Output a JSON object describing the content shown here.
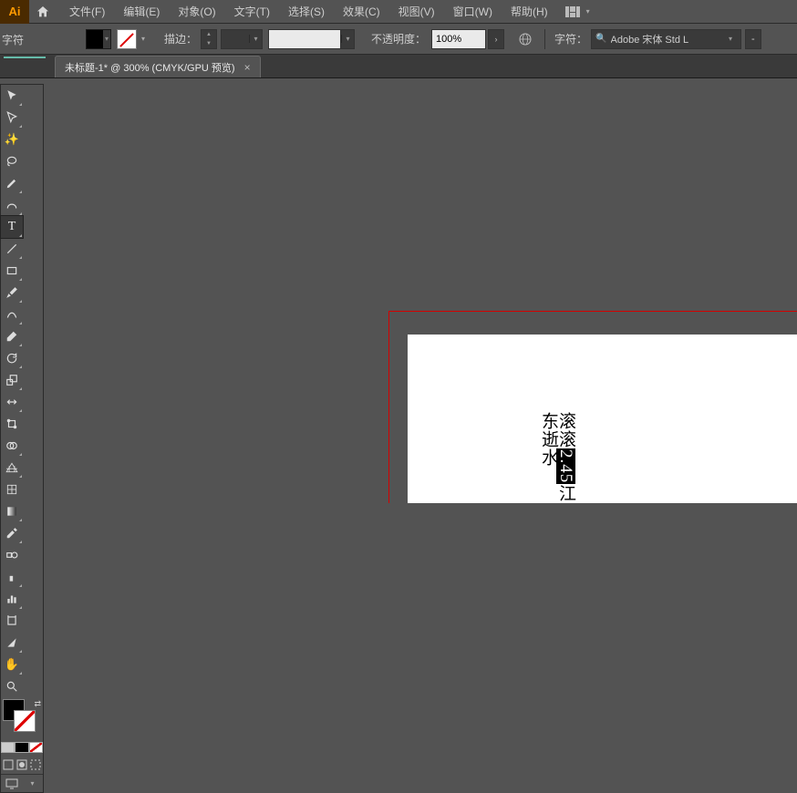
{
  "app": {
    "logo": "Ai"
  },
  "menu": {
    "file": "文件(F)",
    "edit": "编辑(E)",
    "object": "对象(O)",
    "type": "文字(T)",
    "select": "选择(S)",
    "effect": "效果(C)",
    "view": "视图(V)",
    "window": "窗口(W)",
    "help": "帮助(H)"
  },
  "panel_label": "字符",
  "options": {
    "stroke_label": "描边：",
    "opacity_label": "不透明度：",
    "opacity_value": "100%",
    "char_label": "字符：",
    "font_name": "Adobe 宋体 Std L",
    "font_style": "-"
  },
  "tab": {
    "title": "未标题-1* @ 300% (CMYK/GPU 预览)"
  },
  "doc_text": {
    "before": "滚滚",
    "highlight": "2.45",
    "after": "江东逝水"
  }
}
